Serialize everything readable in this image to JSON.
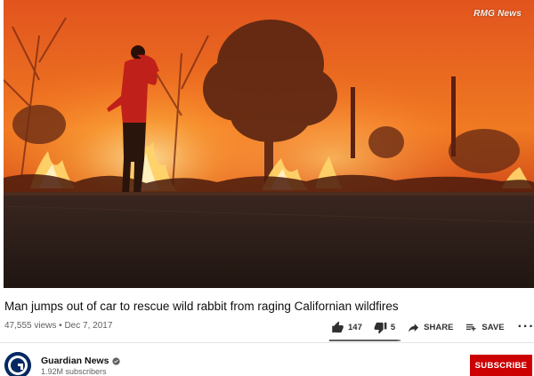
{
  "video": {
    "watermark": "RMG News",
    "title": "Man jumps out of car to rescue wild rabbit from raging Californian wildfires",
    "views": "47,555 views",
    "separator": "•",
    "date": "Dec 7, 2017"
  },
  "actions": {
    "likes": "147",
    "dislikes": "5",
    "like_ratio": 0.967,
    "share_label": "SHARE",
    "save_label": "SAVE",
    "more_label": "···"
  },
  "channel": {
    "name": "Guardian News",
    "subscribers": "1.92M subscribers",
    "subscribe_label": "SUBSCRIBE",
    "avatar_bg": "#052962"
  },
  "colors": {
    "subscribe_red": "#cc0000",
    "fire_orange": "#f07a1a",
    "text_secondary": "#606060"
  }
}
